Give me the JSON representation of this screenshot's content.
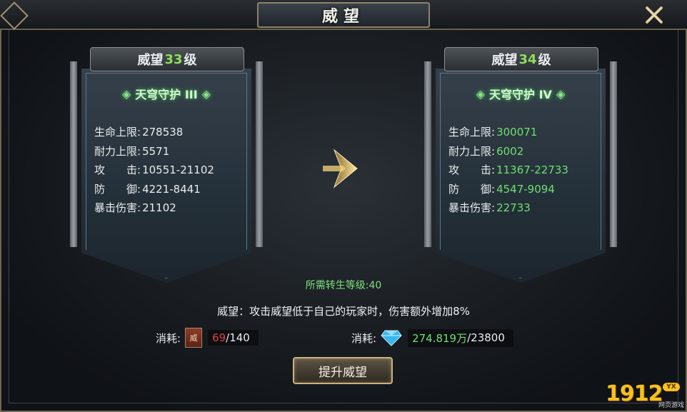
{
  "window": {
    "title": "威望"
  },
  "left_banner": {
    "header_prefix": "威望",
    "header_level": "33",
    "header_suffix": "级",
    "skill": "天穹守护 III",
    "stats": [
      {
        "label": "生命上限:",
        "value": "278538"
      },
      {
        "label": "耐力上限:",
        "value": "5571"
      },
      {
        "label": "攻　　击:",
        "value": "10551-21102"
      },
      {
        "label": "防　　御:",
        "value": "4221-8441"
      },
      {
        "label": "暴击伤害:",
        "value": "21102"
      }
    ]
  },
  "right_banner": {
    "header_prefix": "威望",
    "header_level": "34",
    "header_suffix": "级",
    "skill": "天穹守护 IV",
    "stats": [
      {
        "label": "生命上限:",
        "value": "300071"
      },
      {
        "label": "耐力上限:",
        "value": "6002"
      },
      {
        "label": "攻　　击:",
        "value": "11367-22733"
      },
      {
        "label": "防　　御:",
        "value": "4547-9094"
      },
      {
        "label": "暴击伤害:",
        "value": "22733"
      }
    ]
  },
  "requirement": "所需转生等级:40",
  "description": "威望：攻击威望低于自己的玩家时，伤害额外增加8%",
  "cost_item": {
    "label": "消耗:",
    "icon_text": "威",
    "current": "69",
    "required": "/140"
  },
  "cost_gem": {
    "label": "消耗:",
    "current": "274.819万",
    "required": "/23800"
  },
  "upgrade_button": "提升威望",
  "logo": {
    "number": "1912",
    "badge": "YX",
    "subtitle": "网页游戏"
  },
  "colors": {
    "green": "#6ee070",
    "red": "#e04040",
    "gold": "#f6c21c"
  }
}
